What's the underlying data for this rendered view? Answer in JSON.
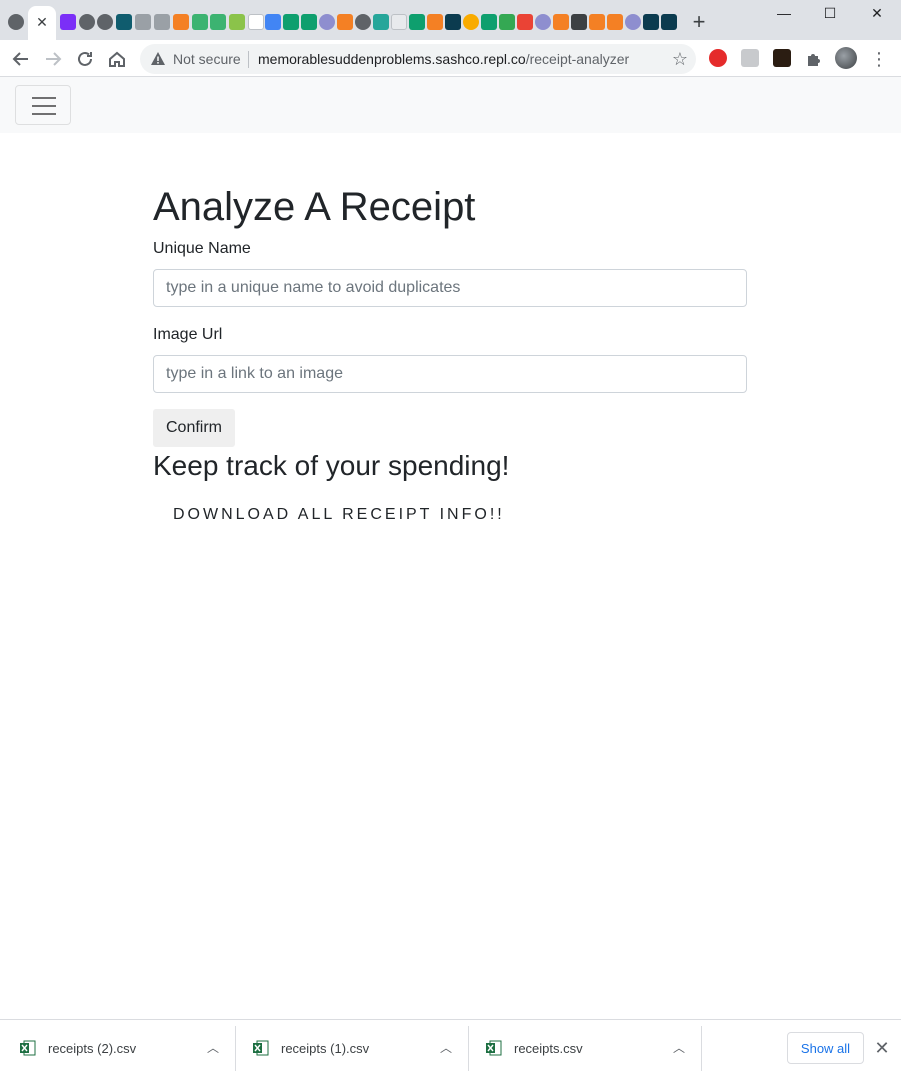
{
  "browser": {
    "active_tab_close": "✕",
    "new_tab": "+",
    "window": {
      "minimize": "—",
      "maximize": "☐",
      "close": "✕"
    },
    "security_label": "Not secure",
    "url_host": "memorablesuddenproblems.sashco.repl.co",
    "url_path": "/receipt-analyzer"
  },
  "page": {
    "title": "Analyze A Receipt",
    "form": {
      "name_label": "Unique Name",
      "name_placeholder": "type in a unique name to avoid duplicates",
      "image_label": "Image Url",
      "image_placeholder": "type in a link to an image",
      "confirm_label": "Confirm"
    },
    "subtitle": "Keep track of your spending!",
    "download_link": "DOWNLOAD ALL RECEIPT INFO!!"
  },
  "downloads": {
    "items": [
      {
        "name": "receipts (2).csv"
      },
      {
        "name": "receipts (1).csv"
      },
      {
        "name": "receipts.csv"
      }
    ],
    "show_all": "Show all"
  },
  "colors": {
    "tab_strip": "#dee1e6",
    "navbar_bg": "#f8f9fa",
    "link_blue": "#1a73e8",
    "text": "#212529"
  }
}
